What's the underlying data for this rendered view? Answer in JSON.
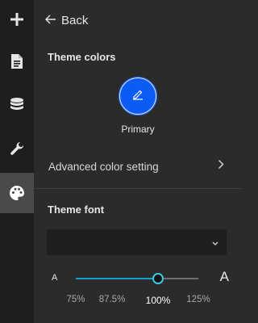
{
  "rail": {
    "items": [
      {
        "icon": "plus-icon"
      },
      {
        "icon": "document-icon"
      },
      {
        "icon": "database-icon"
      },
      {
        "icon": "wrench-icon"
      },
      {
        "icon": "palette-icon",
        "active": true
      }
    ]
  },
  "panel": {
    "back_label": "Back",
    "theme_colors_title": "Theme colors",
    "primary_label": "Primary",
    "primary_color": "#0a5cf5",
    "advanced_label": "Advanced color setting",
    "theme_font_title": "Theme font",
    "font_select_value": "",
    "font_size": {
      "small_glyph": "A",
      "large_glyph": "A",
      "ticks": [
        "75%",
        "87.5%",
        "100%",
        "125%"
      ],
      "selected": "100%",
      "selected_index": 2,
      "value_fraction": 0.67
    }
  },
  "colors": {
    "accent": "#3ec6e0",
    "rail_bg": "#1e1e1e",
    "panel_bg": "#2b2b2b"
  }
}
